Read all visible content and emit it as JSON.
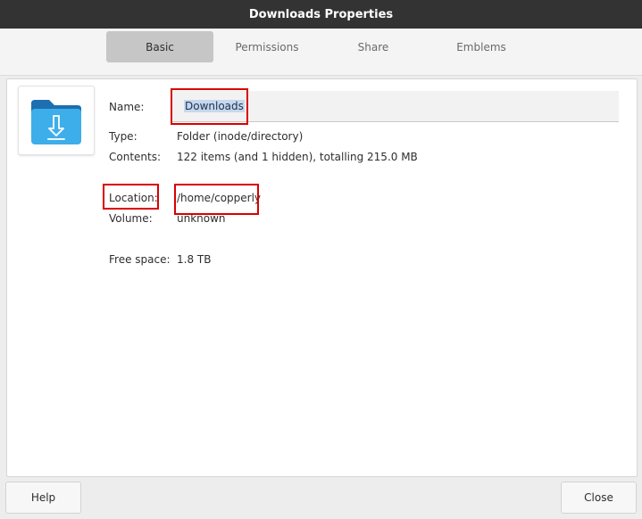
{
  "window": {
    "title": "Downloads Properties"
  },
  "tabs": [
    {
      "label": "Basic",
      "active": true
    },
    {
      "label": "Permissions",
      "active": false
    },
    {
      "label": "Share",
      "active": false
    },
    {
      "label": "Emblems",
      "active": false
    }
  ],
  "basic": {
    "icon": "folder-download-icon",
    "name_label": "Name:",
    "name_value": "Downloads",
    "type_label": "Type:",
    "type_value": "Folder (inode/directory)",
    "contents_label": "Contents:",
    "contents_value": "122 items (and 1 hidden), totalling 215.0 MB",
    "location_label": "Location:",
    "location_value": "/home/copperly",
    "volume_label": "Volume:",
    "volume_value": "unknown",
    "free_space_label": "Free space:",
    "free_space_value": "1.8 TB"
  },
  "footer": {
    "help_label": "Help",
    "close_label": "Close"
  },
  "colors": {
    "titlebar": "#333333",
    "highlight_box": "#d90000",
    "folder_blue": "#3daee9"
  }
}
